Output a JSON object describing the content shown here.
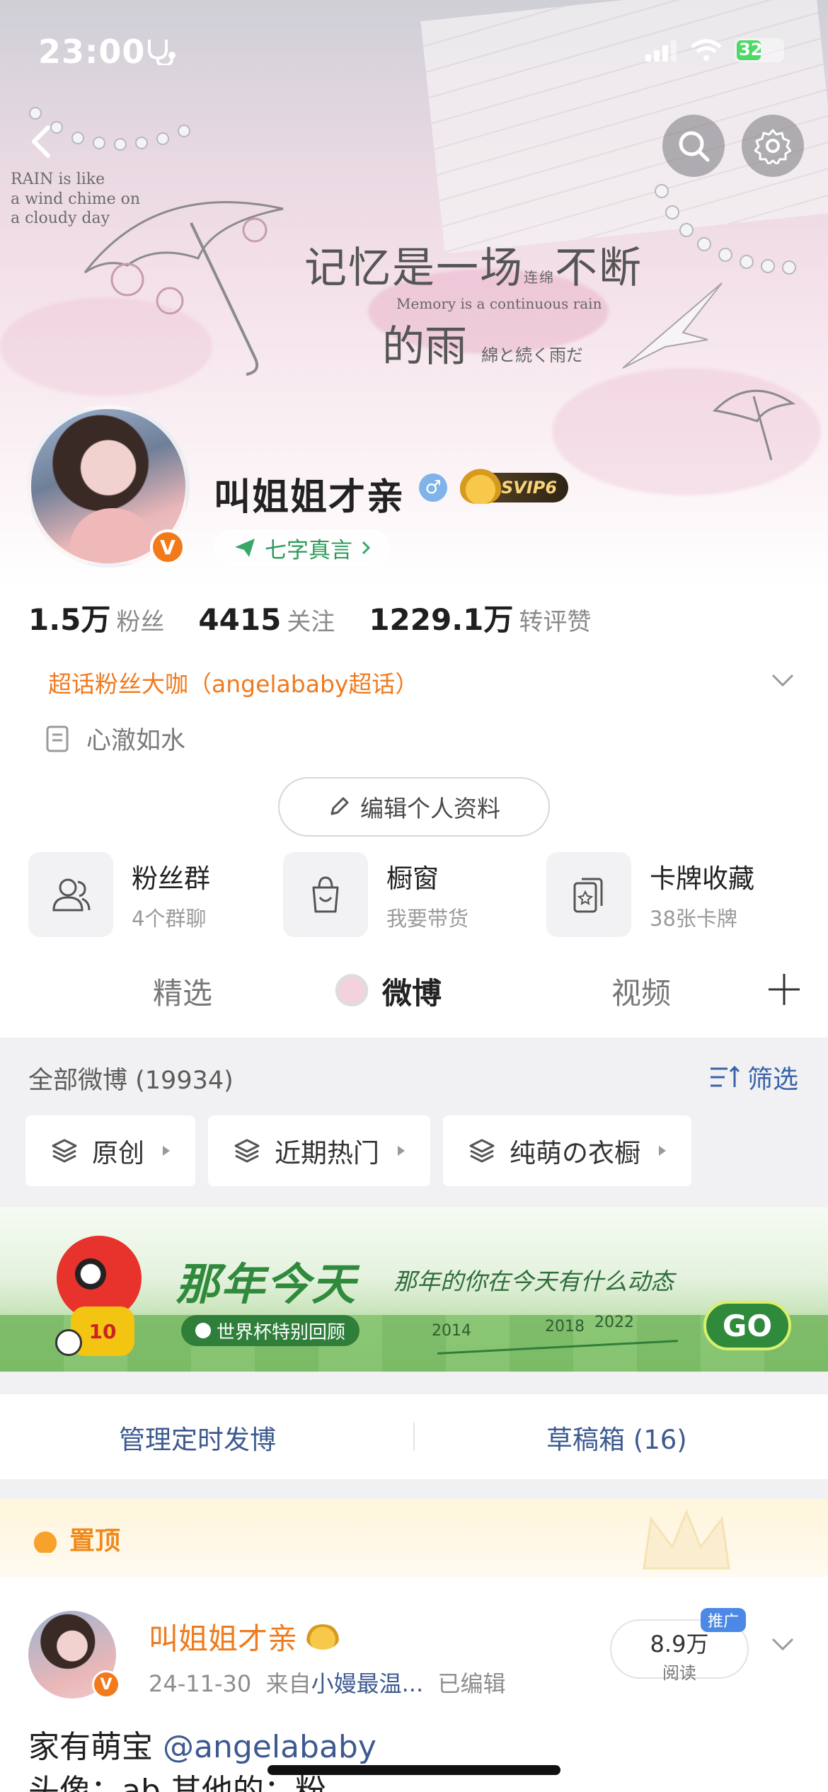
{
  "status_bar": {
    "time": "23:00",
    "battery": "32"
  },
  "cover": {
    "corner_text": [
      "RAIN is like",
      "a wind chime on",
      "a cloudy day"
    ],
    "art_line1": "记忆是一场",
    "art_word": "连绵",
    "art_line1b": "不断",
    "art_english": "Memory is a continuous rain",
    "art_line2": "的雨",
    "art_japanese": "綿と続く雨だ"
  },
  "profile": {
    "nickname": "叫姐姐才亲",
    "gender_symbol": "♂",
    "vip_label": "SVIP6",
    "verified_mark": "V",
    "motto_chip": "七字真言",
    "stats": [
      {
        "value": "1.5万",
        "label": "粉丝"
      },
      {
        "value": "4415",
        "label": "关注"
      },
      {
        "value": "1229.1万",
        "label": "转评赞"
      }
    ],
    "fan_title": "超话粉丝大咖（angelababy超话）",
    "signature": "心澈如水",
    "edit_button": "编辑个人资料"
  },
  "features": [
    {
      "title": "粉丝群",
      "sub": "4个群聊",
      "icon": "group-icon"
    },
    {
      "title": "橱窗",
      "sub": "我要带货",
      "icon": "shopping-bag-icon"
    },
    {
      "title": "卡牌收藏",
      "sub": "38张卡牌",
      "icon": "card-icon"
    }
  ],
  "tabs": [
    "精选",
    "微博",
    "视频"
  ],
  "feed": {
    "all_label": "全部微博 (19934)",
    "filter_label": "筛选",
    "chips": [
      "原创",
      "近期热门",
      "纯萌の衣橱"
    ]
  },
  "banner": {
    "title": "那年今天",
    "subtitle": "那年的你在今天有什么动态",
    "pill": "世界杯特别回顾",
    "years": [
      "2014",
      "2018",
      "2022"
    ],
    "go": "GO",
    "mascot_number": "10"
  },
  "manage": {
    "scheduled": "管理定时发博",
    "drafts": "草稿箱 (16)"
  },
  "post": {
    "pinned_label": "置顶",
    "author": "叫姐姐才亲",
    "date": "24-11-30",
    "from_prefix": "来自",
    "source": "小嫚最温...",
    "edited": "已编辑",
    "reads_value": "8.9万",
    "reads_label": "阅读",
    "promo": "推广",
    "text_prefix": "家有萌宝 ",
    "mention": "@angelababy",
    "text_line2": "头像：ab 其他的：粉"
  }
}
